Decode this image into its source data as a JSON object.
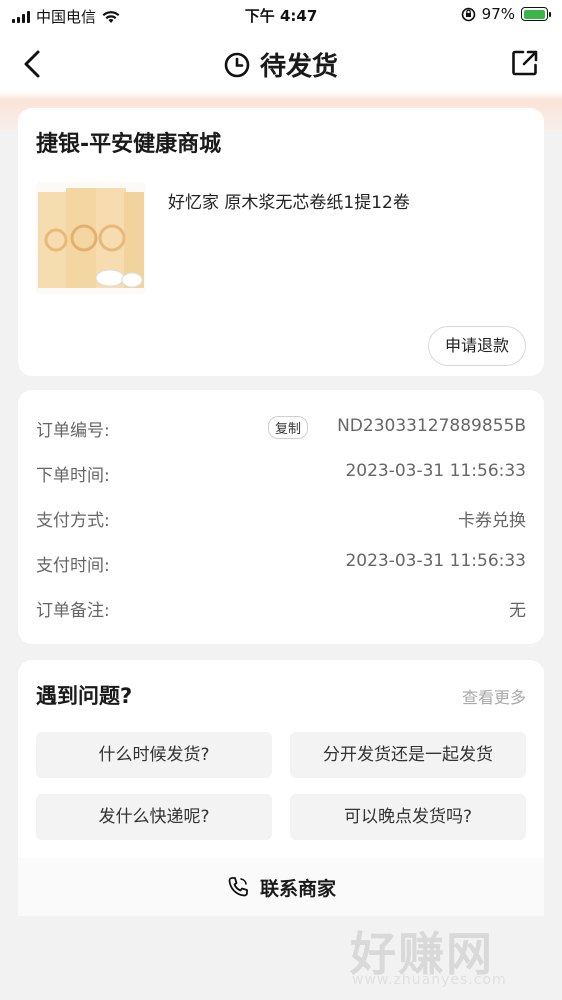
{
  "status_bar": {
    "carrier": "中国电信",
    "time": "下午 4:47",
    "battery": "97%",
    "battery_level": 0.97
  },
  "nav": {
    "title": "待发货"
  },
  "order": {
    "shop_name": "捷银-平安健康商城",
    "product_name": "好忆家 原木浆无芯卷纸1提12卷",
    "refund_label": "申请退款"
  },
  "info": {
    "rows": [
      {
        "label": "订单编号:",
        "value": "ND23033127889855B"
      },
      {
        "label": "下单时间:",
        "value": "2023-03-31 11:56:33"
      },
      {
        "label": "支付方式:",
        "value": "卡券兑换"
      },
      {
        "label": "支付时间:",
        "value": "2023-03-31 11:56:33"
      },
      {
        "label": "订单备注:",
        "value": "无"
      }
    ],
    "copy_label": "复制"
  },
  "faq": {
    "title": "遇到问题?",
    "more": "查看更多",
    "questions": [
      "什么时候发货?",
      "分开发货还是一起发货",
      "发什么快递呢?",
      "可以晚点发货吗?"
    ]
  },
  "contact": {
    "label": "联系商家"
  },
  "watermark": {
    "text": "好赚网",
    "url": "www.zhuanyes.com"
  }
}
